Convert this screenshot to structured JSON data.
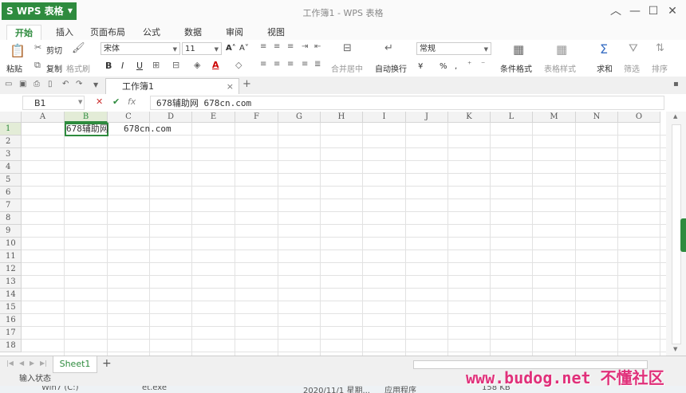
{
  "app": {
    "name": "WPS 表格",
    "window_title": "工作簿1 - WPS 表格"
  },
  "menu": [
    "开始",
    "插入",
    "页面布局",
    "公式",
    "数据",
    "审阅",
    "视图"
  ],
  "ribbon": {
    "paste": "粘贴",
    "cut": "剪切",
    "copy": "复制",
    "format_painter": "格式刷",
    "font_name": "宋体",
    "font_size": "11",
    "bold": "B",
    "italic": "I",
    "underline": "U",
    "merge_center": "合并居中",
    "wrap_text": "自动换行",
    "number_format": "常规",
    "percent": "%",
    "conditional_format": "条件格式",
    "table_style": "表格样式",
    "sum": "求和",
    "filter": "筛选",
    "sort": "排序"
  },
  "doc_tab": {
    "label": "工作簿1",
    "close": "×",
    "add": "+"
  },
  "formula": {
    "name_box": "B1",
    "fx": "fx",
    "content": "678辅助网     678cn.com"
  },
  "grid": {
    "columns": [
      "A",
      "B",
      "C",
      "D",
      "E",
      "F",
      "G",
      "H",
      "I",
      "J",
      "K",
      "L",
      "M",
      "N",
      "O"
    ],
    "rows": [
      "1",
      "2",
      "3",
      "4",
      "5",
      "6",
      "7",
      "8",
      "9",
      "10",
      "11",
      "12",
      "13",
      "14",
      "15",
      "16",
      "17",
      "18"
    ],
    "cells": {
      "B1": "678辅助网",
      "C1": "678cn.com"
    }
  },
  "sheets": {
    "active": "Sheet1",
    "add": "+"
  },
  "status": "输入状态",
  "taskbar": {
    "item1": "Win7 (C:)",
    "item2": "et.exe",
    "item3": "2020/11/1 星期...",
    "item4": "应用程序",
    "item5": "158 KB"
  },
  "watermark": "www.budog.net 不懂社区",
  "colors": {
    "accent": "#2e8b3e"
  }
}
